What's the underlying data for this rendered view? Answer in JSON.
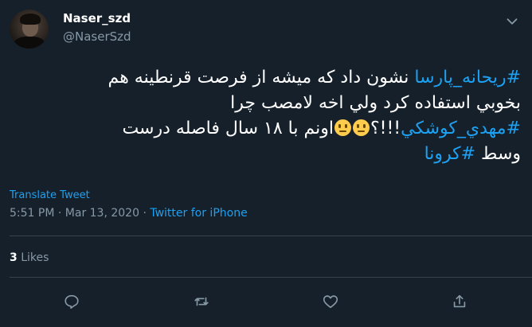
{
  "author": {
    "display_name": "Naser_szd",
    "handle": "@NaserSzd"
  },
  "tweet": {
    "line1": {
      "hashtag": "#ريحانه_پارسا",
      "text": " نشون داد که میشه از فرصت قرنطینه هم"
    },
    "line2": {
      "text": "بخوبي استفاده کرد ولي اخه لامصب چرا"
    },
    "line3": {
      "hashtag": "#مهدي_کوشکي",
      "punct": "!!!؟",
      "text": "اونم با ١٨ سال فاصله درست"
    },
    "line4": {
      "text": "وسط ",
      "hashtag": "#کرونا"
    }
  },
  "translate_label": "Translate Tweet",
  "meta": {
    "time": "5:51 PM",
    "sep1": " · ",
    "date": "Mar 13, 2020",
    "sep2": " · ",
    "source": "Twitter for iPhone"
  },
  "stats": {
    "likes_count": "3",
    "likes_label": " Likes"
  },
  "icons": {
    "caret": "chevron-down-icon",
    "reply": "reply-icon",
    "retweet": "retweet-icon",
    "like": "heart-icon",
    "share": "share-icon",
    "emoji": "neutral-face-emoji"
  },
  "colors": {
    "background": "#15202b",
    "accent": "#1da1f2",
    "secondary_text": "#8899a6",
    "divider": "#38444d"
  }
}
